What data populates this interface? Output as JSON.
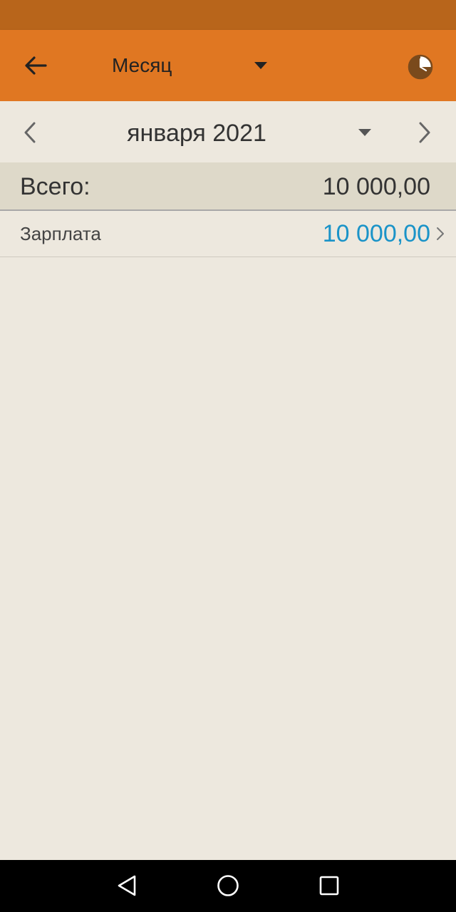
{
  "appbar": {
    "title": "Месяц",
    "back_icon": "arrow-left-icon",
    "dropdown_icon": "caret-down-icon",
    "history_icon": "clock-icon"
  },
  "datebar": {
    "date": "января 2021",
    "prev_icon": "chevron-left-icon",
    "next_icon": "chevron-right-icon",
    "dropdown_icon": "caret-down-icon"
  },
  "total": {
    "label": "Всего:",
    "value": "10 000,00"
  },
  "items": [
    {
      "label": "Зарплата",
      "value": "10 000,00"
    }
  ],
  "colors": {
    "statusbar": "#b8651b",
    "appbar": "#e07722",
    "background": "#ede8de",
    "total_bg": "#ded9c9",
    "amount_accent": "#1a93c8"
  },
  "navbar": {
    "back_icon": "nav-back-icon",
    "home_icon": "nav-home-icon",
    "recents_icon": "nav-recents-icon"
  }
}
